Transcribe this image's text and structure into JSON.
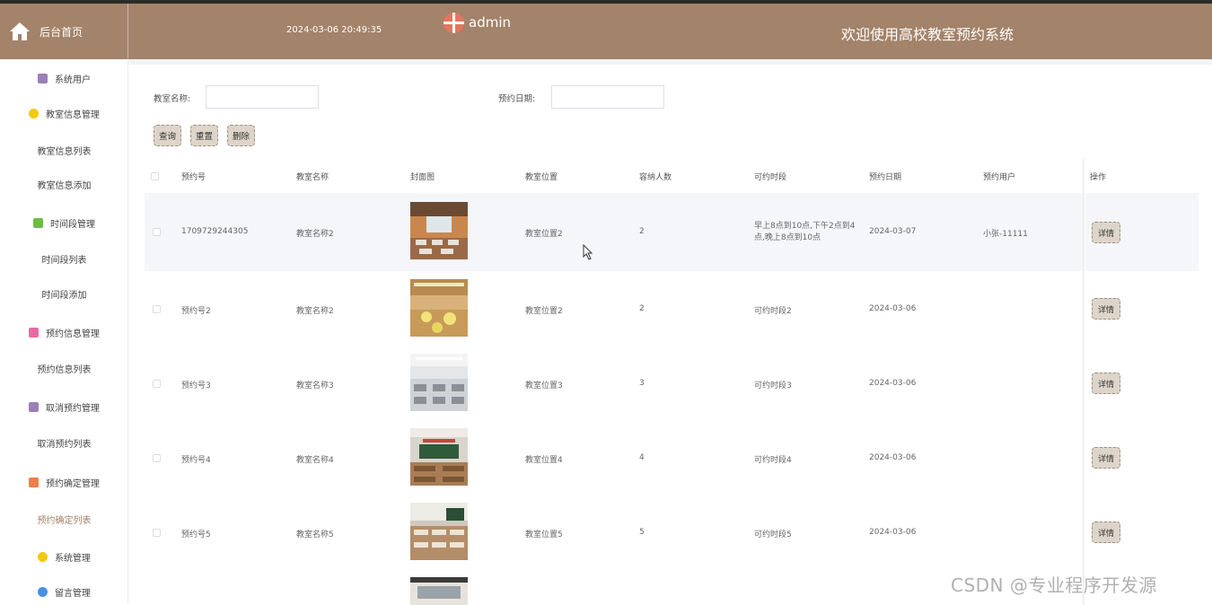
{
  "header": {
    "home_label": "后台首页",
    "datetime": "2024-03-06 20:49:35",
    "username": "admin",
    "welcome": "欢迎使用高校教室预约系统"
  },
  "sidebar": {
    "items": [
      {
        "label": "系统用户",
        "icon": "user-icon",
        "color": "#9b7fb8"
      },
      {
        "label": "教室信息管理",
        "icon": "cube-icon",
        "color": "#f2c811"
      },
      {
        "label": "教室信息列表"
      },
      {
        "label": "教室信息添加"
      },
      {
        "label": "时间段管理",
        "icon": "chat-icon",
        "color": "#6dbd45"
      },
      {
        "label": "时间段列表"
      },
      {
        "label": "时间段添加"
      },
      {
        "label": "预约信息管理",
        "icon": "calendar-icon",
        "color": "#e86aa0"
      },
      {
        "label": "预约信息列表"
      },
      {
        "label": "取消预约管理",
        "icon": "user-icon",
        "color": "#9b7fb8"
      },
      {
        "label": "取消预约列表"
      },
      {
        "label": "预约确定管理",
        "icon": "grid-icon",
        "color": "#f07d4a"
      },
      {
        "label": "预约确定列表"
      },
      {
        "label": "系统管理",
        "icon": "cube-icon",
        "color": "#f2c811"
      },
      {
        "label": "留言管理",
        "icon": "star-icon",
        "color": "#4a90e2"
      }
    ]
  },
  "filters": {
    "room_name_label": "教室名称:",
    "date_label": "预约日期:",
    "room_name_value": "",
    "date_value": ""
  },
  "buttons": {
    "search": "查询",
    "reset": "重置",
    "delete": "删除",
    "detail": "详情"
  },
  "table": {
    "headers": [
      "预约号",
      "教室名称",
      "封面图",
      "教室位置",
      "容纳人数",
      "可约时段",
      "预约日期",
      "预约用户",
      "操作"
    ],
    "rows": [
      {
        "no": "1709729244305",
        "name": "教室名称2",
        "location": "教室位置2",
        "capacity": "2",
        "slot": "早上8点到10点,下午2点到4点,晚上8点到10点",
        "date": "2024-03-07",
        "user": "小张-11111"
      },
      {
        "no": "预约号2",
        "name": "教室名称2",
        "location": "教室位置2",
        "capacity": "2",
        "slot": "可约时段2",
        "date": "2024-03-06",
        "user": ""
      },
      {
        "no": "预约号3",
        "name": "教室名称3",
        "location": "教室位置3",
        "capacity": "3",
        "slot": "可约时段3",
        "date": "2024-03-06",
        "user": ""
      },
      {
        "no": "预约号4",
        "name": "教室名称4",
        "location": "教室位置4",
        "capacity": "4",
        "slot": "可约时段4",
        "date": "2024-03-06",
        "user": ""
      },
      {
        "no": "预约号5",
        "name": "教室名称5",
        "location": "教室位置5",
        "capacity": "5",
        "slot": "可约时段5",
        "date": "2024-03-06",
        "user": ""
      }
    ]
  },
  "watermark": "CSDN @专业程序开发源"
}
